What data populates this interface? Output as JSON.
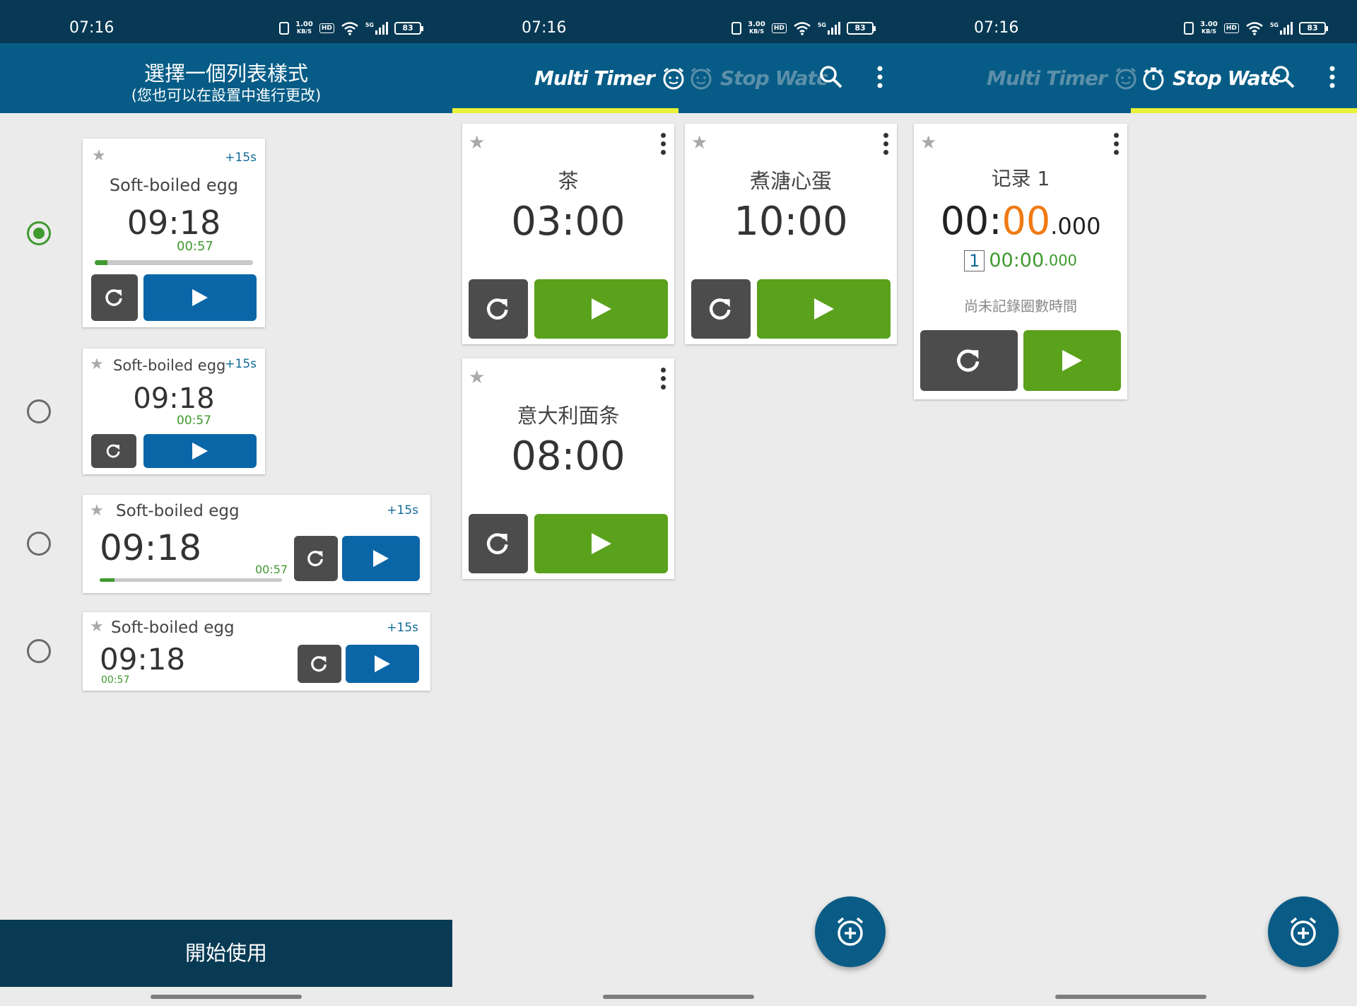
{
  "status_bar": {
    "time": "07:16",
    "speed_left": "1.00",
    "speed_right": "3.00",
    "speed_unit": "KB/S",
    "hd": "HD",
    "network": "5G",
    "battery": "83"
  },
  "panel1": {
    "title": "選擇一個列表樣式",
    "subtitle": "(您也可以在設置中進行更改)",
    "styles": [
      {
        "name": "Soft-boiled egg",
        "time": "09:18",
        "elapsed": "00:57",
        "plus": "+15s",
        "progress": 0.08,
        "selected": true
      },
      {
        "name": "Soft-boiled egg",
        "time": "09:18",
        "elapsed": "00:57",
        "plus": "+15s",
        "selected": false
      },
      {
        "name": "Soft-boiled egg",
        "time": "09:18",
        "elapsed": "00:57",
        "plus": "+15s",
        "progress": 0.08,
        "selected": false
      },
      {
        "name": "Soft-boiled egg",
        "time": "09:18",
        "elapsed": "00:57",
        "plus": "+15s",
        "selected": false
      }
    ],
    "start_button": "開始使用"
  },
  "tabs": {
    "multi_timer": "Multi Timer",
    "stop_watch": "Stop Watc"
  },
  "panel2": {
    "timers": [
      {
        "name": "茶",
        "time": "03:00"
      },
      {
        "name": "煮溏心蛋",
        "time": "10:00"
      },
      {
        "name": "意大利面条",
        "time": "08:00"
      }
    ]
  },
  "panel3": {
    "stopwatch": {
      "name": "记录 1",
      "time_hh": "00:",
      "time_ss": "00",
      "time_ms": ".000",
      "lap_number": "1",
      "lap_time": "00:00",
      "lap_ms": ".000",
      "no_laps_text": "尚未記錄圈數時間"
    }
  },
  "icons": {
    "star": "star-icon",
    "reset": "refresh-icon",
    "play": "play-icon",
    "search": "search-icon",
    "menu": "more-vert-icon",
    "add_timer": "alarm-add-icon"
  },
  "colors": {
    "appbar": "#065c86",
    "statusbar": "#073954",
    "tab_indicator": "#e9f238",
    "play_green": "#5aa11c",
    "play_blue": "#0b66a8",
    "reset_gray": "#4c4c4c",
    "accent_green": "#3f9a2f",
    "accent_orange": "#ef7a13"
  }
}
